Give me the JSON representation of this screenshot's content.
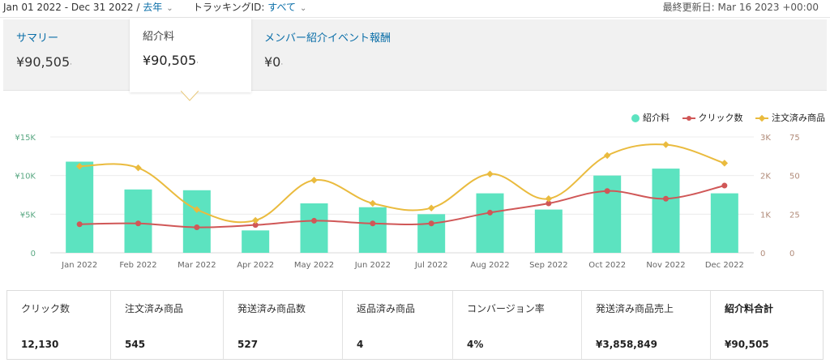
{
  "header": {
    "date_range": "Jan 01 2022 - Dec 31 2022 /",
    "period": "去年",
    "tracking_label": "トラッキングID:",
    "tracking_value": "すべて",
    "last_updated": "最終更新日: Mar 16 2023 +00:00"
  },
  "summary_tabs": [
    {
      "label": "サマリー",
      "value": "¥90,505",
      "selected": false
    },
    {
      "label": "紹介料",
      "value": "¥90,505",
      "selected": true
    },
    {
      "label": "メンバー紹介イベント報酬",
      "value": "¥0",
      "selected": false
    }
  ],
  "legend": {
    "fees": "紹介料",
    "clicks": "クリック数",
    "ordered": "注文済み商品"
  },
  "colors": {
    "bar": "#5ce3c0",
    "clicks": "#d05757",
    "ordered": "#eabb3e",
    "link": "#0a6ea8",
    "axis_left": "#5aa883",
    "axis_right": "#b08a78"
  },
  "stats": [
    {
      "label": "クリック数",
      "value": "12,130"
    },
    {
      "label": "注文済み商品",
      "value": "545"
    },
    {
      "label": "発送済み商品数",
      "value": "527"
    },
    {
      "label": "返品済み商品",
      "value": "4"
    },
    {
      "label": "コンバージョン率",
      "value": "4%"
    },
    {
      "label": "発送済み商品売上",
      "value": "¥3,858,849"
    },
    {
      "label": "紹介料合計",
      "value": "¥90,505"
    }
  ],
  "chart_data": {
    "type": "bar",
    "categories": [
      "Jan 2022",
      "Feb 2022",
      "Mar 2022",
      "Apr 2022",
      "May 2022",
      "Jun 2022",
      "Jul 2022",
      "Aug 2022",
      "Sep 2022",
      "Oct 2022",
      "Nov 2022",
      "Dec 2022"
    ],
    "series": [
      {
        "name": "紹介料",
        "type": "bar",
        "axis": "left",
        "values": [
          11800,
          8200,
          8100,
          2900,
          6400,
          5900,
          5000,
          7700,
          5600,
          10000,
          10900,
          7700
        ]
      },
      {
        "name": "クリック数",
        "type": "line",
        "axis": "right1",
        "values": [
          740,
          760,
          660,
          720,
          830,
          760,
          760,
          1040,
          1280,
          1600,
          1400,
          1740
        ]
      },
      {
        "name": "注文済み商品",
        "type": "line",
        "axis": "right2",
        "values": [
          56,
          55,
          28,
          21,
          47,
          32,
          29,
          51,
          35,
          63,
          70,
          58
        ]
      }
    ],
    "y_left": {
      "ticks": [
        "0",
        "¥5K",
        "¥10K",
        "¥15K"
      ],
      "range": [
        0,
        15000
      ]
    },
    "y_right1": {
      "ticks": [
        "0",
        "1K",
        "2K",
        "3K"
      ],
      "range": [
        0,
        3000
      ]
    },
    "y_right2": {
      "ticks": [
        "0",
        "25",
        "50",
        "75"
      ],
      "range": [
        0,
        75
      ]
    },
    "grid": true,
    "legend_position": "top-right"
  }
}
